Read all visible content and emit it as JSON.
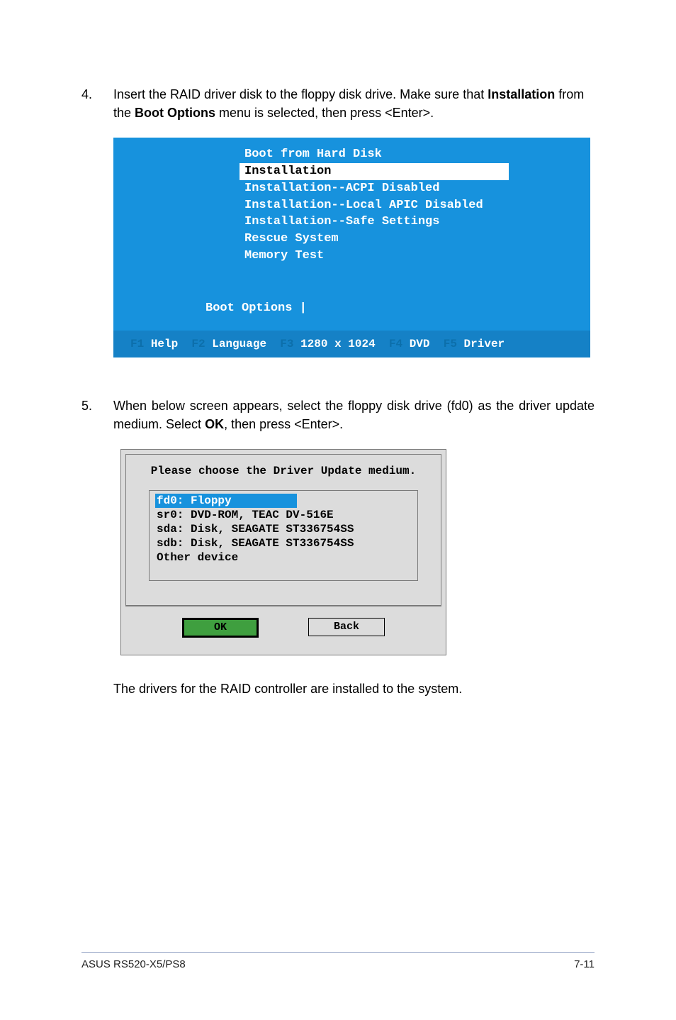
{
  "step4": {
    "num": "4.",
    "text_pre": "Insert the RAID driver disk to the floppy disk drive. Make sure that ",
    "bold1": "Installation",
    "text_mid": " from the ",
    "bold2": "Boot Options",
    "text_post": " menu is selected, then press <Enter>."
  },
  "boot": {
    "lines": [
      "Boot from Hard Disk",
      "Installation",
      "Installation--ACPI Disabled",
      "Installation--Local APIC Disabled",
      "Installation--Safe Settings",
      "Rescue System",
      "Memory Test"
    ],
    "options_label": "Boot Options",
    "cursor": "|",
    "bottom": {
      "f1": "F1",
      "help": "Help",
      "f2": "F2",
      "language": "Language",
      "f3": "F3",
      "res": "1280 x 1024",
      "f4": "F4",
      "dvd": "DVD",
      "f5": "F5",
      "driver": "Driver"
    }
  },
  "step5": {
    "num": "5.",
    "text_pre": "When below screen appears, select the floppy disk drive (fd0) as the driver update medium. Select ",
    "bold1": "OK",
    "text_post": ", then press <Enter>."
  },
  "dialog": {
    "title": "Please choose the Driver Update medium.",
    "items": [
      "fd0: Floppy",
      "sr0: DVD-ROM, TEAC DV-516E",
      "sda: Disk, SEAGATE ST336754SS",
      "sdb: Disk, SEAGATE ST336754SS",
      "Other device"
    ],
    "ok": "OK",
    "back": "Back"
  },
  "closing": "The drivers for the RAID controller are installed to the system.",
  "footer_left": "ASUS RS520-X5/PS8",
  "footer_right": "7-11"
}
